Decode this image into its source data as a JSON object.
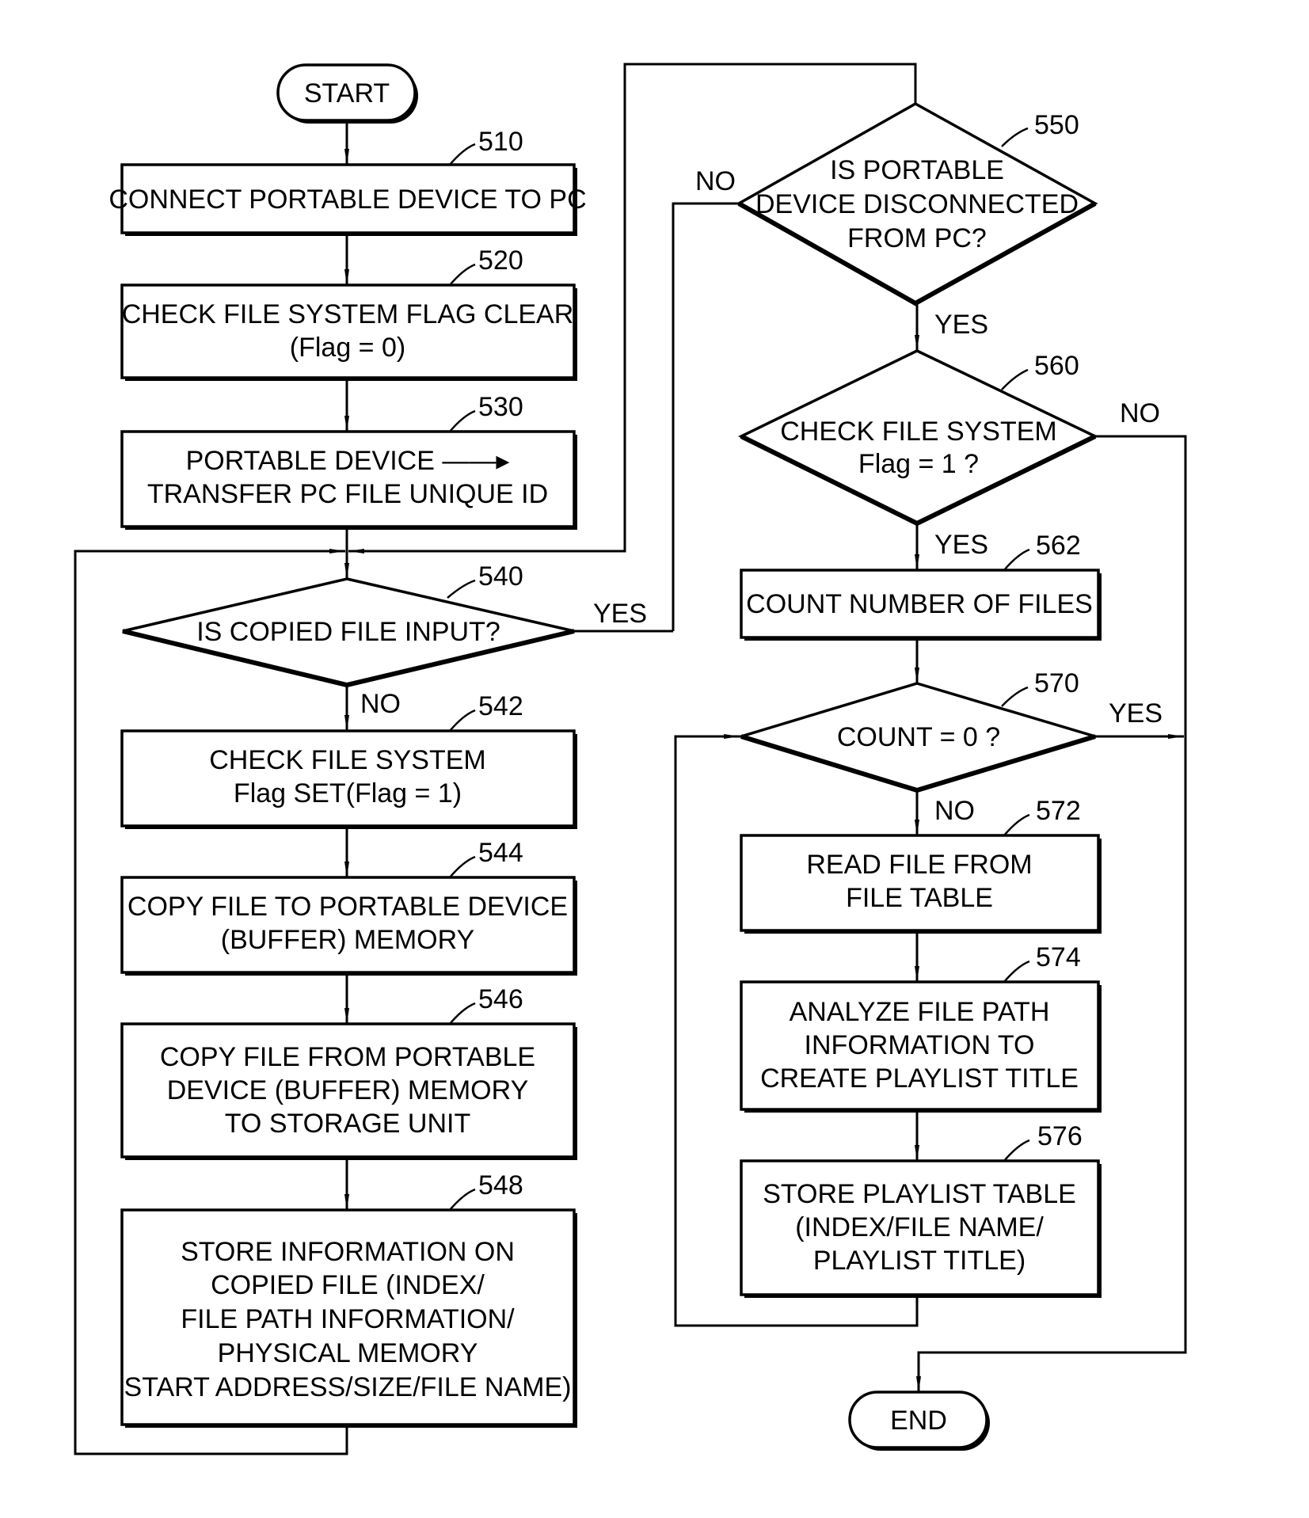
{
  "diagram": {
    "type": "flowchart",
    "nodes": {
      "start": {
        "text": [
          "START"
        ]
      },
      "n510": {
        "ref": "510",
        "text": [
          "CONNECT PORTABLE DEVICE TO PC"
        ]
      },
      "n520": {
        "ref": "520",
        "text": [
          "CHECK FILE SYSTEM FLAG CLEAR",
          "(Flag = 0)"
        ]
      },
      "n530": {
        "ref": "530",
        "text": [
          "PORTABLE DEVICE ——▸",
          "TRANSFER PC FILE UNIQUE ID"
        ]
      },
      "n540": {
        "ref": "540",
        "text": [
          "IS COPIED FILE INPUT?"
        ]
      },
      "n542": {
        "ref": "542",
        "text": [
          "CHECK FILE SYSTEM",
          "Flag SET(Flag = 1)"
        ]
      },
      "n544": {
        "ref": "544",
        "text": [
          "COPY FILE TO PORTABLE DEVICE",
          "(BUFFER) MEMORY"
        ]
      },
      "n546": {
        "ref": "546",
        "text": [
          "COPY FILE FROM PORTABLE",
          "DEVICE (BUFFER) MEMORY",
          "TO STORAGE UNIT"
        ]
      },
      "n548": {
        "ref": "548",
        "text": [
          "STORE INFORMATION ON",
          "COPIED FILE (INDEX/",
          "FILE PATH INFORMATION/",
          "PHYSICAL MEMORY",
          "START ADDRESS/SIZE/FILE NAME)"
        ]
      },
      "n550": {
        "ref": "550",
        "text": [
          "IS PORTABLE",
          "DEVICE DISCONNECTED",
          "FROM PC?"
        ]
      },
      "n560": {
        "ref": "560",
        "text": [
          "CHECK FILE SYSTEM",
          "Flag = 1 ?"
        ]
      },
      "n562": {
        "ref": "562",
        "text": [
          "COUNT NUMBER OF FILES"
        ]
      },
      "n570": {
        "ref": "570",
        "text": [
          "COUNT = 0 ?"
        ]
      },
      "n572": {
        "ref": "572",
        "text": [
          "READ FILE FROM",
          "FILE TABLE"
        ]
      },
      "n574": {
        "ref": "574",
        "text": [
          "ANALYZE FILE PATH",
          "INFORMATION TO",
          "CREATE PLAYLIST TITLE"
        ]
      },
      "n576": {
        "ref": "576",
        "text": [
          "STORE PLAYLIST TABLE",
          "(INDEX/FILE NAME/",
          "PLAYLIST TITLE)"
        ]
      },
      "end": {
        "text": [
          "END"
        ]
      }
    },
    "branch_labels": {
      "b540_yes": "YES",
      "b540_no": "NO",
      "b550_no": "NO",
      "b550_yes": "YES",
      "b560_no": "NO",
      "b560_yes": "YES",
      "b570_yes": "YES",
      "b570_no": "NO"
    },
    "edges": [
      {
        "from": "start",
        "to": "n510"
      },
      {
        "from": "n510",
        "to": "n520"
      },
      {
        "from": "n520",
        "to": "n530"
      },
      {
        "from": "n530",
        "to": "n540"
      },
      {
        "from": "n540",
        "to": "n550",
        "label": "YES"
      },
      {
        "from": "n540",
        "to": "n542",
        "label": "NO"
      },
      {
        "from": "n542",
        "to": "n544"
      },
      {
        "from": "n544",
        "to": "n546"
      },
      {
        "from": "n546",
        "to": "n548"
      },
      {
        "from": "n548",
        "to": "n540"
      },
      {
        "from": "n550",
        "to": "n540",
        "label": "NO"
      },
      {
        "from": "n550",
        "to": "n560",
        "label": "YES"
      },
      {
        "from": "n560",
        "to": "end",
        "label": "NO"
      },
      {
        "from": "n560",
        "to": "n562",
        "label": "YES"
      },
      {
        "from": "n562",
        "to": "n570"
      },
      {
        "from": "n570",
        "to": "end",
        "label": "YES"
      },
      {
        "from": "n570",
        "to": "n572",
        "label": "NO"
      },
      {
        "from": "n572",
        "to": "n574"
      },
      {
        "from": "n574",
        "to": "n576"
      },
      {
        "from": "n576",
        "to": "n570"
      }
    ]
  }
}
